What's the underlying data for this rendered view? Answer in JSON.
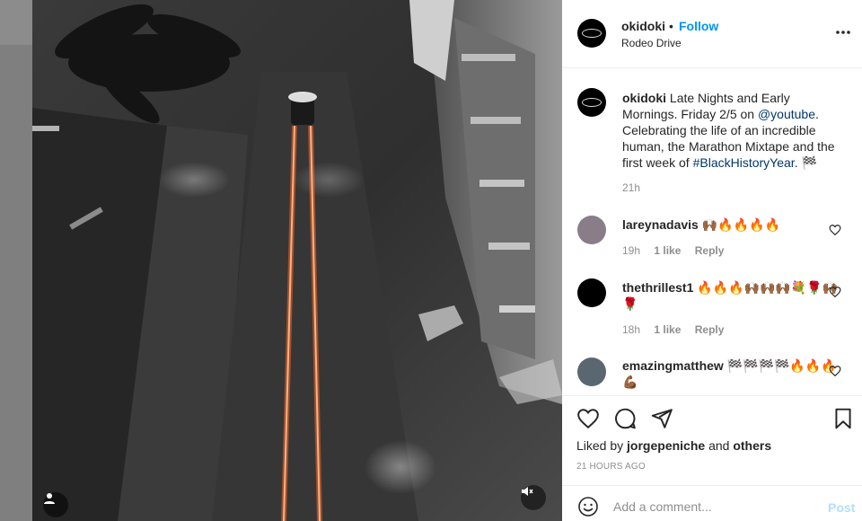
{
  "post": {
    "username": "okidoki",
    "separator": "•",
    "follow_label": "Follow",
    "location": "Rodeo Drive",
    "more_icon": "more-horizontal-icon"
  },
  "caption": {
    "username": "okidoki",
    "text_1": " Late Nights and Early Mornings. Friday 2/5 on ",
    "mention": "@youtube",
    "text_2": ". Celebrating the life of an incredible human, the Marathon Mixtape and the first week of ",
    "hashtag": "#BlackHistoryYear",
    "text_3": ". 🏁",
    "time": "21h"
  },
  "comments": [
    {
      "username": "lareynadavis",
      "text": "🙌🏾🔥🔥🔥🔥",
      "time": "19h",
      "likes": "1 like",
      "reply": "Reply"
    },
    {
      "username": "thethrillest1",
      "text": "🔥🔥🔥🙌🏾🙌🏾🙌🏾💐🌹🙌🏾🌹",
      "time": "18h",
      "likes": "1 like",
      "reply": "Reply"
    },
    {
      "username": "emazingmatthew",
      "text": "🏁🏁🏁🏁🔥🔥🔥💪🏾",
      "time": "",
      "likes": "",
      "reply": ""
    }
  ],
  "actions": {
    "like_icon": "heart-icon",
    "comment_icon": "comment-bubble-icon",
    "share_icon": "paper-plane-icon",
    "save_icon": "bookmark-icon"
  },
  "likes": {
    "prefix": "Liked by ",
    "user": "jorgepeniche",
    "middle": " and ",
    "others": "others"
  },
  "timestamp": "21 HOURS AGO",
  "add_comment": {
    "placeholder": "Add a comment...",
    "post_label": "Post",
    "emoji_icon": "smiley-icon"
  },
  "media": {
    "user_tag_icon": "person-icon",
    "mute_icon": "speaker-muted-icon"
  },
  "colors": {
    "accent_link": "#0095f6",
    "post_disabled": "#b2dffc",
    "mention_link": "#00376b",
    "light_trail": "#ff5a1f"
  }
}
